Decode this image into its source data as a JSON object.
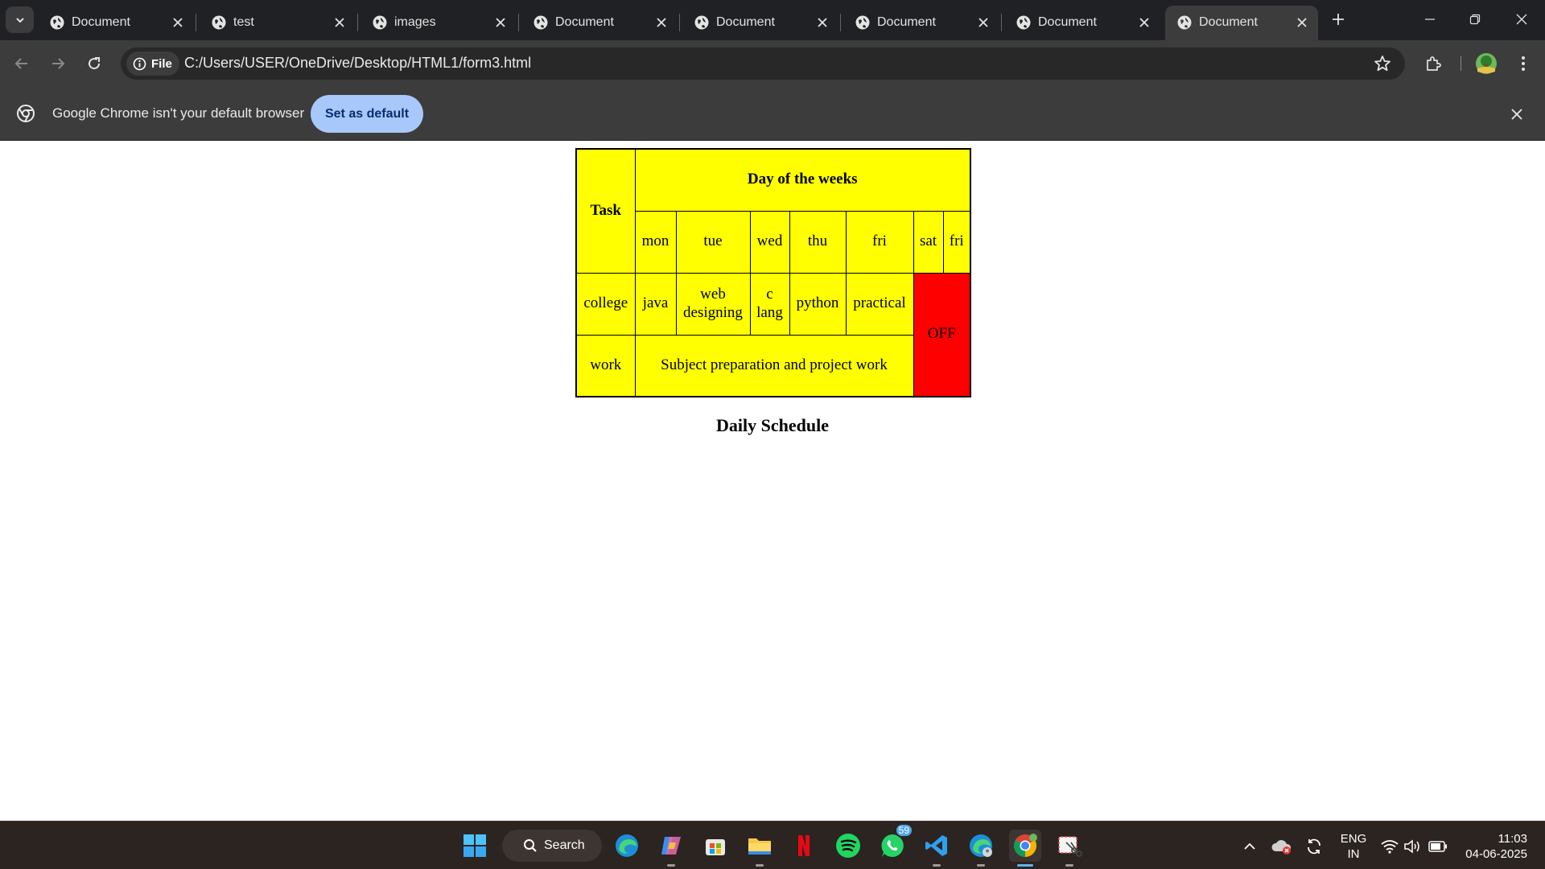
{
  "browser": {
    "tabs": [
      {
        "title": "Document"
      },
      {
        "title": "test"
      },
      {
        "title": "images"
      },
      {
        "title": "Document"
      },
      {
        "title": "Document"
      },
      {
        "title": "Document"
      },
      {
        "title": "Document"
      },
      {
        "title": "Document",
        "active": true
      }
    ],
    "address": {
      "chip_label": "File",
      "url": "C:/Users/USER/OneDrive/Desktop/HTML1/form3.html"
    },
    "infobar": {
      "message": "Google Chrome isn't your default browser",
      "button_label": "Set as default"
    }
  },
  "page": {
    "table": {
      "task_header": "Task",
      "days_header": "Day of the weeks",
      "days": [
        "mon",
        "tue",
        "wed",
        "thu",
        "fri",
        "sat",
        "fri"
      ],
      "rows": [
        {
          "task": "college",
          "cells": [
            "java",
            "web designing",
            "c lang",
            "python",
            "practical"
          ]
        },
        {
          "task": "work",
          "merged": "Subject preparation and project work"
        }
      ],
      "off_label": "OFF"
    },
    "caption": "Daily Schedule"
  },
  "taskbar": {
    "search_label": "Search",
    "whatsapp_badge": "59",
    "language": {
      "line1": "ENG",
      "line2": "IN"
    },
    "clock": {
      "time": "11:03",
      "date": "04-06-2025"
    }
  },
  "colors": {
    "table_bg": "#ffff00",
    "off_bg": "#ff0000",
    "default_button": "#a8c7fa",
    "active_indicator": "#5fb2f2"
  }
}
